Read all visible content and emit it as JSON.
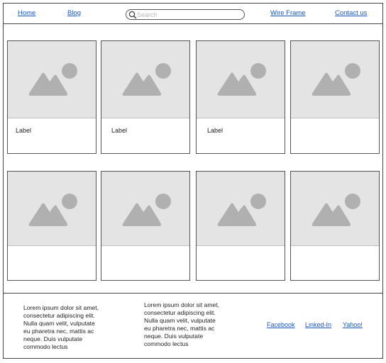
{
  "header": {
    "nav_left": [
      {
        "label": "Home"
      },
      {
        "label": "Blog"
      }
    ],
    "search": {
      "placeholder": "Search",
      "value": ""
    },
    "nav_right": [
      {
        "label": "Wire Frame"
      },
      {
        "label": "Contact us"
      }
    ]
  },
  "gallery": {
    "row1": [
      {
        "label": "Label"
      },
      {
        "label": "Label"
      },
      {
        "label": "Label"
      },
      {
        "label": ""
      }
    ],
    "row2": [
      {
        "label": ""
      },
      {
        "label": ""
      },
      {
        "label": ""
      },
      {
        "label": ""
      }
    ],
    "placeholder_icon": "image-placeholder-icon"
  },
  "footer": {
    "text_blocks": [
      "Lorem ipsum dolor sit amet, consectetur adipiscing elit. Nulla quam velit, vulputate eu pharetra nec, mattis ac neque. Duis vulputate commodo lectus",
      "Lorem ipsum dolor sit amet, consectetur adipiscing elit. Nulla quam velit, vulputate eu pharetra nec, mattis ac neque. Duis vulputate commodo lectus"
    ],
    "links": [
      {
        "label": "Facebook"
      },
      {
        "label": "Linked-In"
      },
      {
        "label": "Yahoo!"
      }
    ]
  },
  "colors": {
    "link": "#1a56c4",
    "placeholder_bg": "#e4e4e4",
    "placeholder_icon": "#b0b0b0",
    "border": "#444444"
  }
}
